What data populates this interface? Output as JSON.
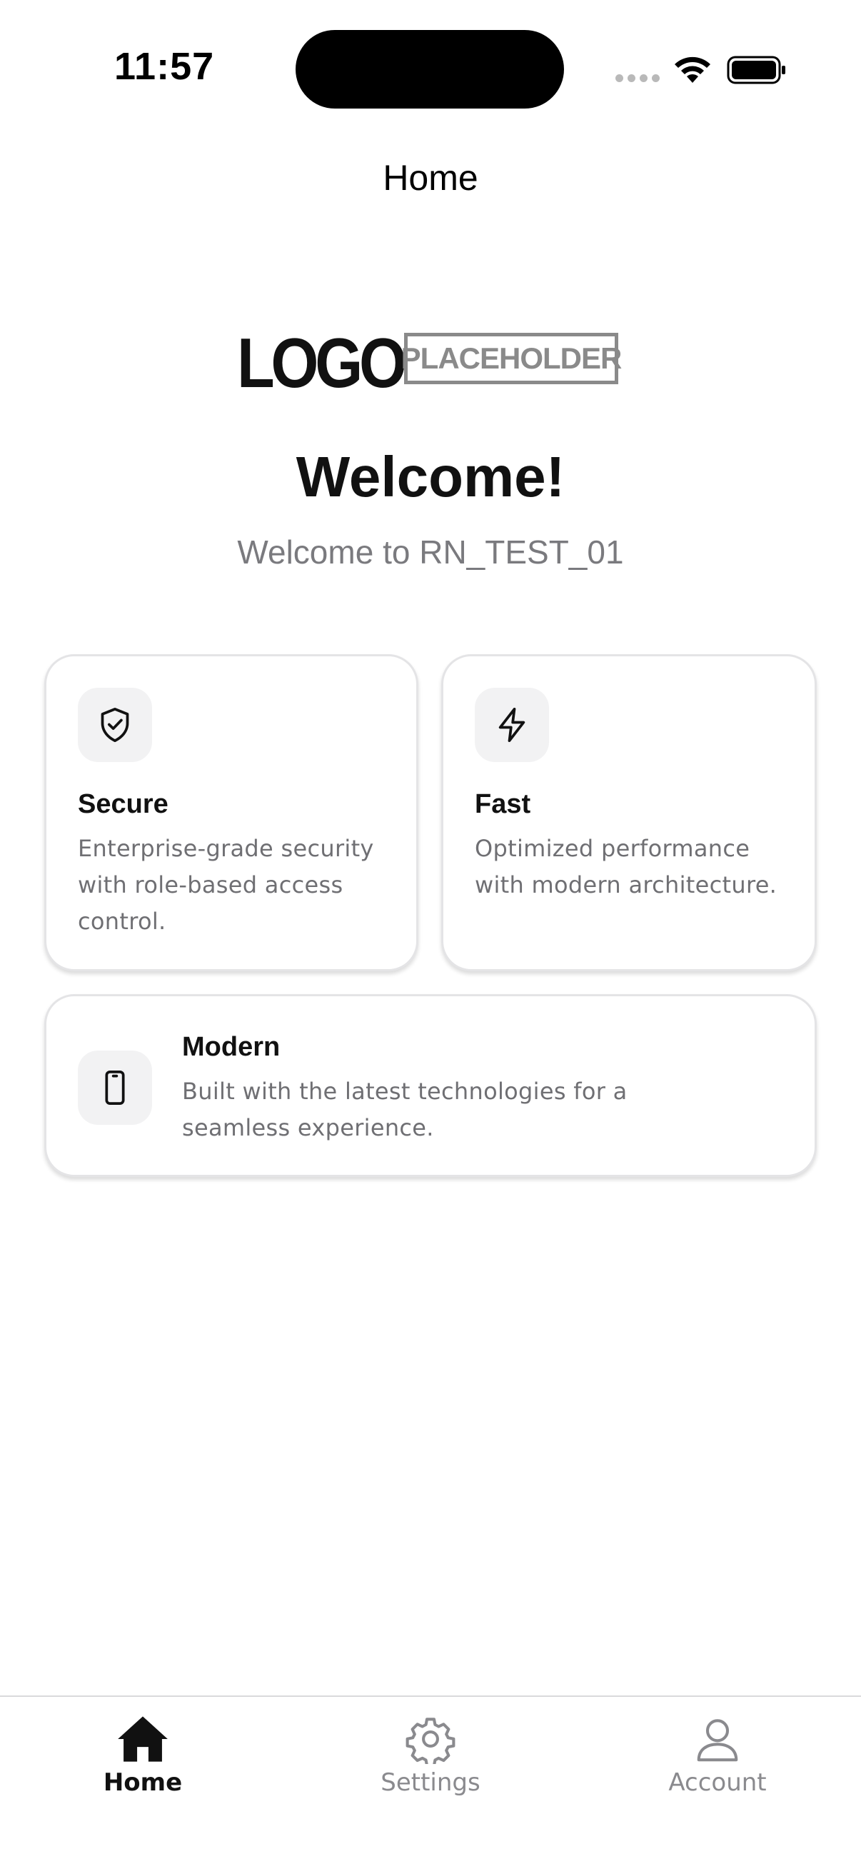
{
  "status_bar": {
    "time": "11:57"
  },
  "nav": {
    "title": "Home"
  },
  "logo": {
    "word": "LOGO",
    "tag": "PLACEHOLDER"
  },
  "welcome": {
    "title": "Welcome!",
    "subtitle": "Welcome to RN_TEST_01"
  },
  "features": [
    {
      "title": "Secure",
      "icon": "shield-check-icon",
      "description": "Enterprise-grade security with role-based access control."
    },
    {
      "title": "Fast",
      "icon": "lightning-icon",
      "description": "Optimized performance with modern architecture."
    },
    {
      "title": "Modern",
      "icon": "smartphone-icon",
      "description": "Built with the latest technologies for a seamless experience."
    }
  ],
  "tabs": [
    {
      "label": "Home",
      "icon": "home-icon",
      "active": true
    },
    {
      "label": "Settings",
      "icon": "gear-icon",
      "active": false
    },
    {
      "label": "Account",
      "icon": "person-icon",
      "active": false
    }
  ],
  "colors": {
    "text": "#111111",
    "muted": "#7a7a7e",
    "card_border": "#e4e4e6",
    "icon_bg": "#f2f2f3"
  }
}
